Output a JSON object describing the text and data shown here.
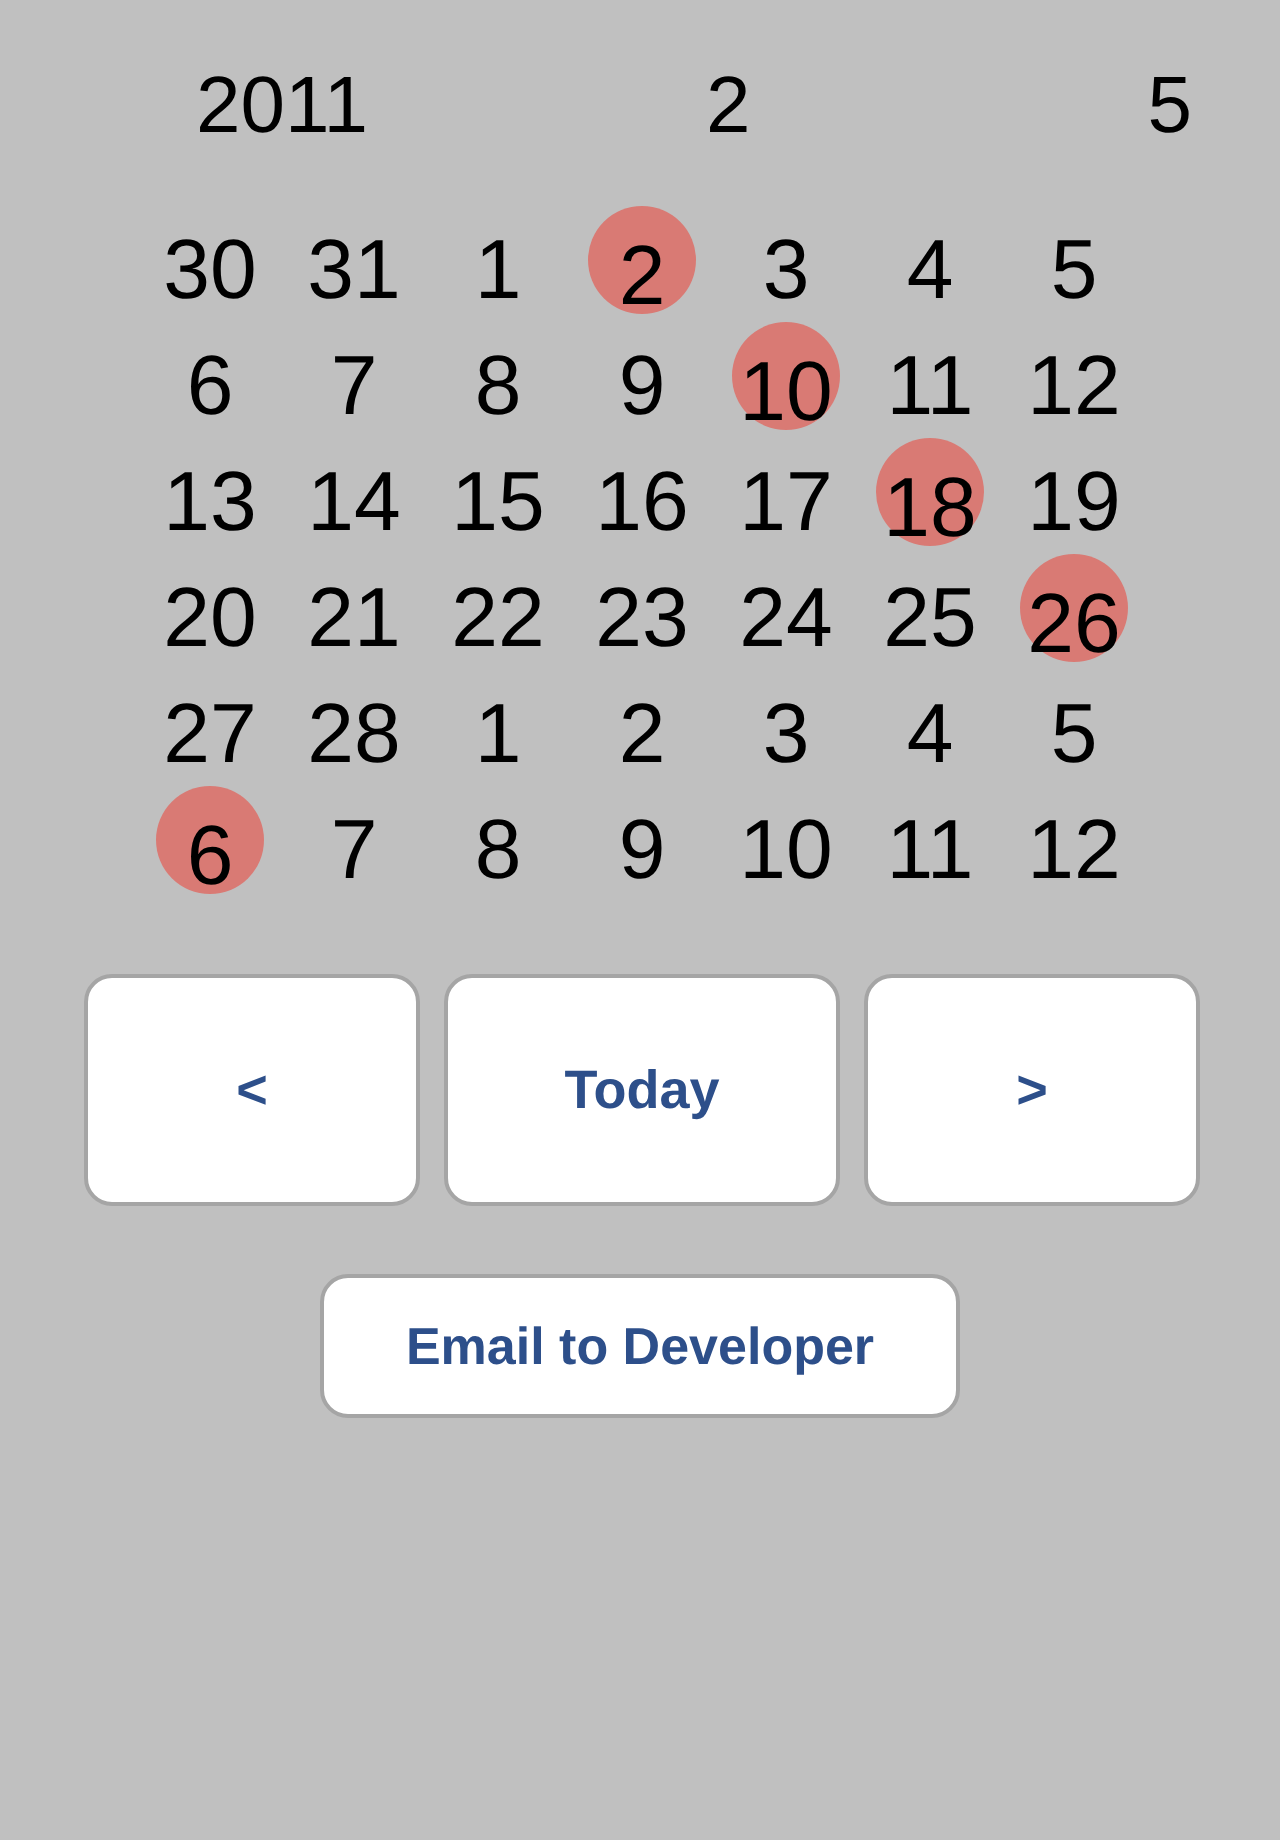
{
  "header": {
    "year": "2011",
    "month": "2",
    "day": "5"
  },
  "days": [
    {
      "label": "30",
      "marked": false
    },
    {
      "label": "31",
      "marked": false
    },
    {
      "label": "1",
      "marked": false
    },
    {
      "label": "2",
      "marked": true
    },
    {
      "label": "3",
      "marked": false
    },
    {
      "label": "4",
      "marked": false
    },
    {
      "label": "5",
      "marked": false
    },
    {
      "label": "6",
      "marked": false
    },
    {
      "label": "7",
      "marked": false
    },
    {
      "label": "8",
      "marked": false
    },
    {
      "label": "9",
      "marked": false
    },
    {
      "label": "10",
      "marked": true
    },
    {
      "label": "11",
      "marked": false
    },
    {
      "label": "12",
      "marked": false
    },
    {
      "label": "13",
      "marked": false
    },
    {
      "label": "14",
      "marked": false
    },
    {
      "label": "15",
      "marked": false
    },
    {
      "label": "16",
      "marked": false
    },
    {
      "label": "17",
      "marked": false
    },
    {
      "label": "18",
      "marked": true
    },
    {
      "label": "19",
      "marked": false
    },
    {
      "label": "20",
      "marked": false
    },
    {
      "label": "21",
      "marked": false
    },
    {
      "label": "22",
      "marked": false
    },
    {
      "label": "23",
      "marked": false
    },
    {
      "label": "24",
      "marked": false
    },
    {
      "label": "25",
      "marked": false
    },
    {
      "label": "26",
      "marked": true
    },
    {
      "label": "27",
      "marked": false
    },
    {
      "label": "28",
      "marked": false
    },
    {
      "label": "1",
      "marked": false
    },
    {
      "label": "2",
      "marked": false
    },
    {
      "label": "3",
      "marked": false
    },
    {
      "label": "4",
      "marked": false
    },
    {
      "label": "5",
      "marked": false
    },
    {
      "label": "6",
      "marked": true
    },
    {
      "label": "7",
      "marked": false
    },
    {
      "label": "8",
      "marked": false
    },
    {
      "label": "9",
      "marked": false
    },
    {
      "label": "10",
      "marked": false
    },
    {
      "label": "11",
      "marked": false
    },
    {
      "label": "12",
      "marked": false
    }
  ],
  "nav_buttons": [
    {
      "kind": "prev",
      "label": "<"
    },
    {
      "kind": "today",
      "label": "Today"
    },
    {
      "kind": "next",
      "label": ">"
    }
  ],
  "email_button": "Email to Developer"
}
